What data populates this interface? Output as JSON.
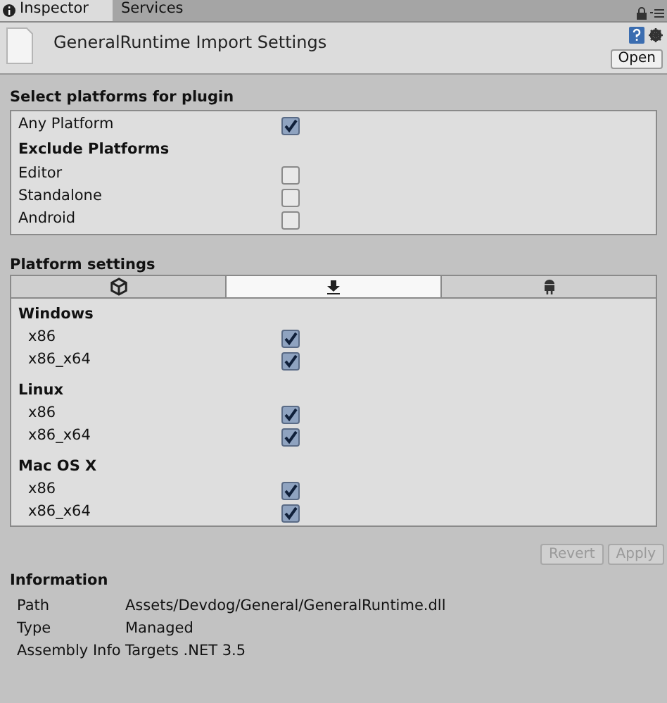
{
  "window_tabs": [
    {
      "label": "Inspector",
      "selected": true
    },
    {
      "label": "Services",
      "selected": false
    }
  ],
  "header": {
    "title": "GeneralRuntime Import Settings",
    "open_button": "Open"
  },
  "plugin_platforms": {
    "title": "Select platforms for plugin",
    "any_platform": {
      "label": "Any Platform",
      "checked": true
    },
    "exclude_title": "Exclude Platforms",
    "exclude": [
      {
        "label": "Editor",
        "checked": false
      },
      {
        "label": "Standalone",
        "checked": false
      },
      {
        "label": "Android",
        "checked": false
      }
    ]
  },
  "platform_settings": {
    "title": "Platform settings",
    "tabs": [
      {
        "kind": "unity",
        "selected": false
      },
      {
        "kind": "standalone",
        "selected": true
      },
      {
        "kind": "android",
        "selected": false
      }
    ],
    "groups": [
      {
        "name": "Windows",
        "options": [
          {
            "label": "x86",
            "checked": true
          },
          {
            "label": "x86_x64",
            "checked": true
          }
        ]
      },
      {
        "name": "Linux",
        "options": [
          {
            "label": "x86",
            "checked": true
          },
          {
            "label": "x86_x64",
            "checked": true
          }
        ]
      },
      {
        "name": "Mac OS X",
        "options": [
          {
            "label": "x86",
            "checked": true
          },
          {
            "label": "x86_x64",
            "checked": true
          }
        ]
      }
    ]
  },
  "buttons": [
    {
      "label": "Revert",
      "disabled": true
    },
    {
      "label": "Apply",
      "disabled": true
    }
  ],
  "information": {
    "title": "Information",
    "rows": [
      {
        "key": "Path",
        "value": "Assets/Devdog/General/GeneralRuntime.dll"
      },
      {
        "key": "Type",
        "value": "Managed"
      },
      {
        "key": "Assembly Info",
        "value": "Targets .NET 3.5"
      }
    ]
  }
}
